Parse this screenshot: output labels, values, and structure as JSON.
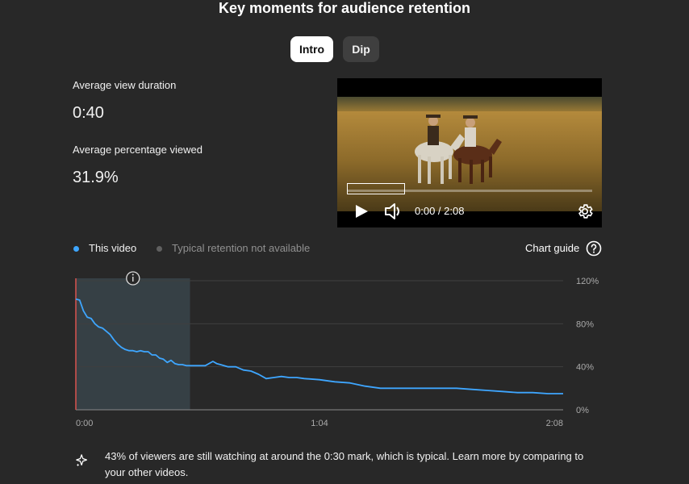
{
  "header": {
    "title": "Key moments for audience retention"
  },
  "tabs": [
    {
      "label": "Intro",
      "selected": true
    },
    {
      "label": "Dip",
      "selected": false
    }
  ],
  "stats": {
    "avg_view_duration_label": "Average view duration",
    "avg_view_duration_value": "0:40",
    "avg_pct_viewed_label": "Average percentage viewed",
    "avg_pct_viewed_value": "31.9%"
  },
  "player": {
    "time": "0:00 / 2:08",
    "icons": [
      "play-icon",
      "volume-icon",
      "settings-gear-icon"
    ]
  },
  "legend": {
    "this_video": "This video",
    "typical": "Typical retention not available",
    "chart_guide": "Chart guide",
    "colors": {
      "this_video": "#3ea6ff",
      "typical": "#606060"
    }
  },
  "chart_data": {
    "type": "line",
    "x_tick_labels": [
      "0:00",
      "1:04",
      "2:08"
    ],
    "y_tick_labels": [
      "120%",
      "80%",
      "40%",
      "0%"
    ],
    "ylim": [
      0,
      120
    ],
    "xlim": [
      0,
      128
    ],
    "x_unit": "seconds",
    "highlight_range": [
      0,
      30
    ],
    "grid": true,
    "series": [
      {
        "name": "This video",
        "color": "#3ea6ff",
        "x": [
          0,
          1,
          2,
          3,
          4,
          5,
          6,
          7,
          8,
          9,
          10,
          11,
          12,
          13,
          14,
          15,
          16,
          17,
          18,
          19,
          20,
          21,
          22,
          23,
          24,
          25,
          26,
          27,
          28,
          29,
          30,
          32,
          34,
          36,
          37,
          38,
          40,
          42,
          44,
          46,
          48,
          50,
          52,
          54,
          56,
          58,
          60,
          64,
          68,
          72,
          76,
          80,
          84,
          88,
          92,
          96,
          100,
          104,
          108,
          112,
          116,
          120,
          124,
          128
        ],
        "values": [
          103,
          102,
          92,
          86,
          85,
          80,
          77,
          76,
          73,
          70,
          65,
          61,
          58,
          56,
          55,
          55,
          54,
          55,
          54,
          54,
          51,
          51,
          48,
          47,
          44,
          46,
          43,
          42,
          42,
          41,
          41,
          41,
          41,
          45,
          43,
          42,
          40,
          40,
          37,
          36,
          33,
          29,
          30,
          31,
          30,
          30,
          29,
          28,
          26,
          25,
          22,
          20,
          20,
          20,
          20,
          20,
          20,
          19,
          18,
          17,
          16,
          16,
          15,
          15
        ]
      }
    ]
  },
  "insight": {
    "text": "43% of viewers are still watching at around the 0:30 mark, which is typical. Learn more by comparing to your other videos."
  }
}
